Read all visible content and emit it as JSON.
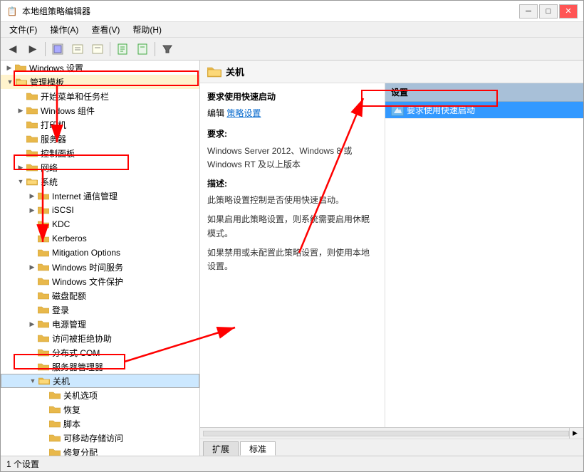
{
  "window": {
    "title": "本地组策略编辑器",
    "title_icon": "📋"
  },
  "title_controls": {
    "minimize": "─",
    "maximize": "□",
    "close": "✕"
  },
  "menu": {
    "items": [
      "文件(F)",
      "操作(A)",
      "查看(V)",
      "帮助(H)"
    ]
  },
  "toolbar": {
    "buttons": [
      "◀",
      "▶",
      "📋",
      "📋",
      "📋",
      "📋",
      "🔍"
    ]
  },
  "tree": {
    "items": [
      {
        "id": "windows-settings",
        "label": "Windows 设置",
        "level": 0,
        "expand": "closed",
        "type": "folder"
      },
      {
        "id": "admin-templates",
        "label": "管理模板",
        "level": 0,
        "expand": "open",
        "type": "folder",
        "selected": false
      },
      {
        "id": "start-menu",
        "label": "开始菜单和任务栏",
        "level": 1,
        "expand": "none",
        "type": "folder"
      },
      {
        "id": "windows-components",
        "label": "Windows 组件",
        "level": 1,
        "expand": "closed",
        "type": "folder"
      },
      {
        "id": "printer",
        "label": "打印机",
        "level": 1,
        "expand": "none",
        "type": "folder"
      },
      {
        "id": "server",
        "label": "服务器",
        "level": 1,
        "expand": "none",
        "type": "folder"
      },
      {
        "id": "control-panel",
        "label": "控制面板",
        "level": 1,
        "expand": "none",
        "type": "folder"
      },
      {
        "id": "network",
        "label": "网络",
        "level": 1,
        "expand": "closed",
        "type": "folder"
      },
      {
        "id": "system",
        "label": "系统",
        "level": 1,
        "expand": "open",
        "type": "folder",
        "selected": false
      },
      {
        "id": "internet-comm",
        "label": "Internet 通信管理",
        "level": 2,
        "expand": "closed",
        "type": "folder"
      },
      {
        "id": "iscsi",
        "label": "iSCSI",
        "level": 2,
        "expand": "closed",
        "type": "folder"
      },
      {
        "id": "kdc",
        "label": "KDC",
        "level": 2,
        "expand": "none",
        "type": "folder"
      },
      {
        "id": "kerberos",
        "label": "Kerberos",
        "level": 2,
        "expand": "none",
        "type": "folder"
      },
      {
        "id": "mitigation",
        "label": "Mitigation Options",
        "level": 2,
        "expand": "none",
        "type": "folder"
      },
      {
        "id": "windows-time",
        "label": "Windows 时间服务",
        "level": 2,
        "expand": "closed",
        "type": "folder"
      },
      {
        "id": "windows-file",
        "label": "Windows 文件保护",
        "level": 2,
        "expand": "none",
        "type": "folder"
      },
      {
        "id": "disk-quota",
        "label": "磁盘配额",
        "level": 2,
        "expand": "none",
        "type": "folder"
      },
      {
        "id": "login",
        "label": "登录",
        "level": 2,
        "expand": "none",
        "type": "folder"
      },
      {
        "id": "power-mgmt",
        "label": "电源管理",
        "level": 2,
        "expand": "closed",
        "type": "folder"
      },
      {
        "id": "access-denied",
        "label": "访问被拒绝协助",
        "level": 2,
        "expand": "none",
        "type": "folder"
      },
      {
        "id": "distributed-com",
        "label": "分布式 COM",
        "level": 2,
        "expand": "none",
        "type": "folder"
      },
      {
        "id": "server-mgr",
        "label": "服务器管理器",
        "level": 2,
        "expand": "none",
        "type": "folder"
      },
      {
        "id": "shutdown",
        "label": "关机",
        "level": 2,
        "expand": "open",
        "type": "folder",
        "highlighted": true
      },
      {
        "id": "shutdown-options",
        "label": "关机选项",
        "level": 3,
        "expand": "none",
        "type": "folder"
      },
      {
        "id": "restore",
        "label": "恢复",
        "level": 3,
        "expand": "none",
        "type": "folder"
      },
      {
        "id": "script",
        "label": "脚本",
        "level": 3,
        "expand": "none",
        "type": "folder"
      },
      {
        "id": "removable-storage",
        "label": "可移动存储访问",
        "level": 3,
        "expand": "none",
        "type": "folder"
      },
      {
        "id": "service-distribution",
        "label": "修复分配",
        "level": 3,
        "expand": "none",
        "type": "folder"
      }
    ]
  },
  "right_header": {
    "icon": "📁",
    "title": "关机"
  },
  "desc_pane": {
    "policy_title": "要求使用快速启动",
    "edit_label": "编辑",
    "policy_setting_link": "策略设置",
    "require_label": "要求:",
    "require_text": "Windows Server 2012、Windows 8 或 Windows RT 及以上版本",
    "desc_label": "描述:",
    "desc_text": "此策略设置控制是否使用快速启动。",
    "if_enabled_label": "如果启用此策略设置，则系统需要启用休眠模式。",
    "if_disabled_label": "如果禁用或未配置此策略设置，则使用本地设置。"
  },
  "settings_pane": {
    "header": "设置",
    "items": [
      {
        "label": "要求使用快速启动",
        "selected": true
      }
    ]
  },
  "tabs": [
    {
      "label": "扩展",
      "active": false
    },
    {
      "label": "标准",
      "active": true
    }
  ],
  "status_bar": {
    "text": "1 个设置"
  }
}
